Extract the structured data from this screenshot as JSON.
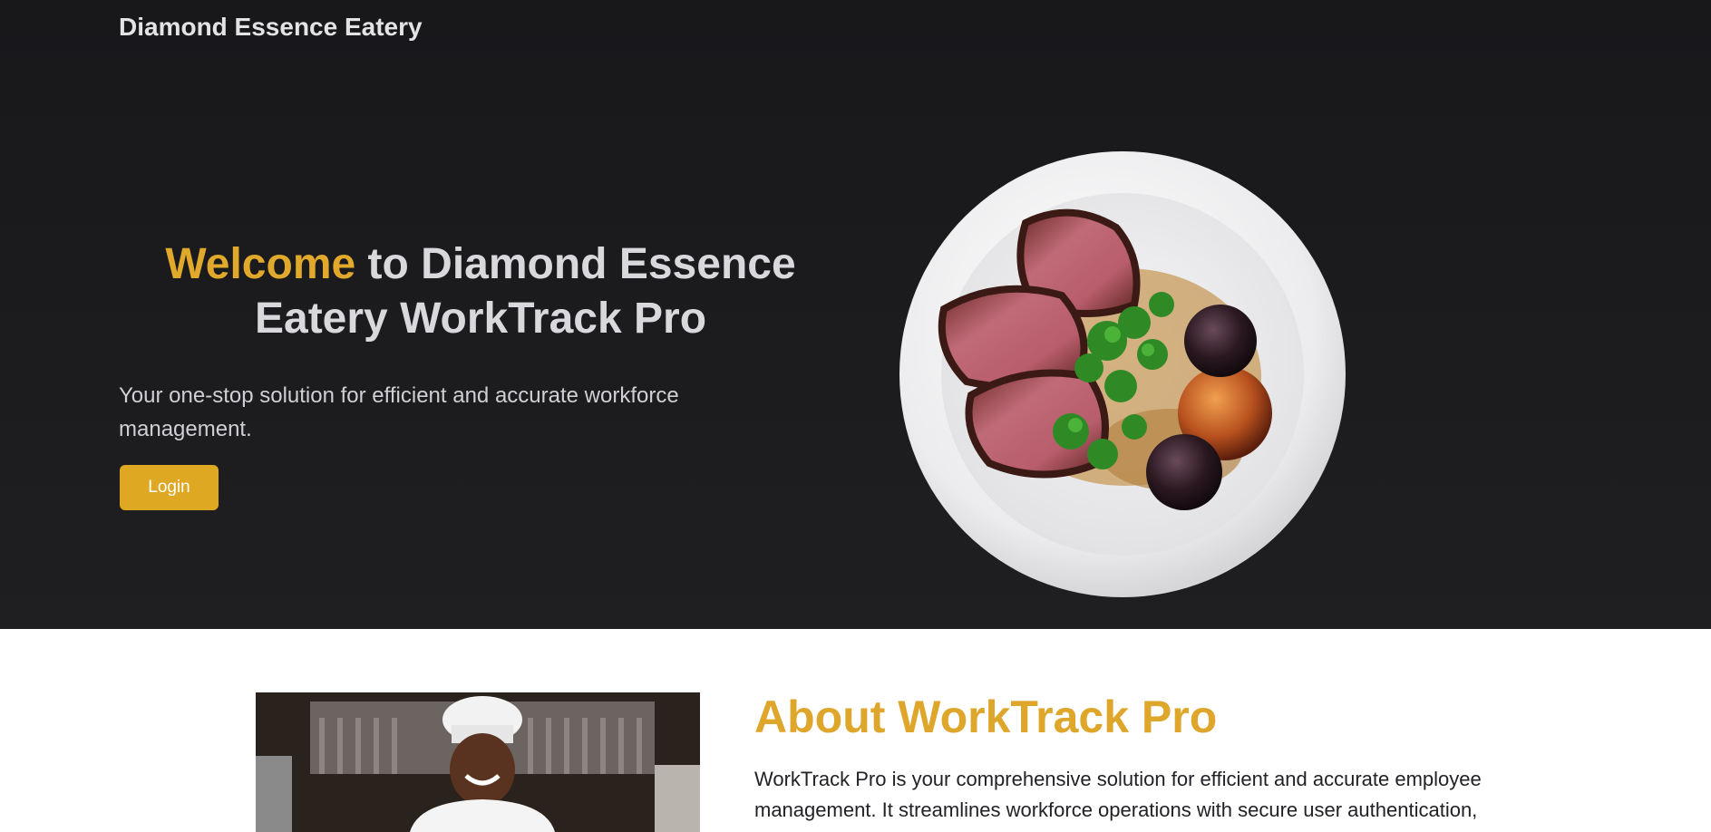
{
  "header": {
    "brand": "Diamond Essence Eatery"
  },
  "hero": {
    "title_accent": "Welcome",
    "title_rest": " to Diamond Essence Eatery WorkTrack Pro",
    "subtitle": "Your one-stop solution for efficient and accurate workforce management.",
    "login_label": "Login"
  },
  "about": {
    "title": "About WorkTrack Pro",
    "body": "WorkTrack Pro is your comprehensive solution for efficient and accurate employee management. It streamlines workforce operations with secure user authentication,"
  },
  "colors": {
    "accent": "#dfa823",
    "hero_bg": "#1c1c1e"
  }
}
